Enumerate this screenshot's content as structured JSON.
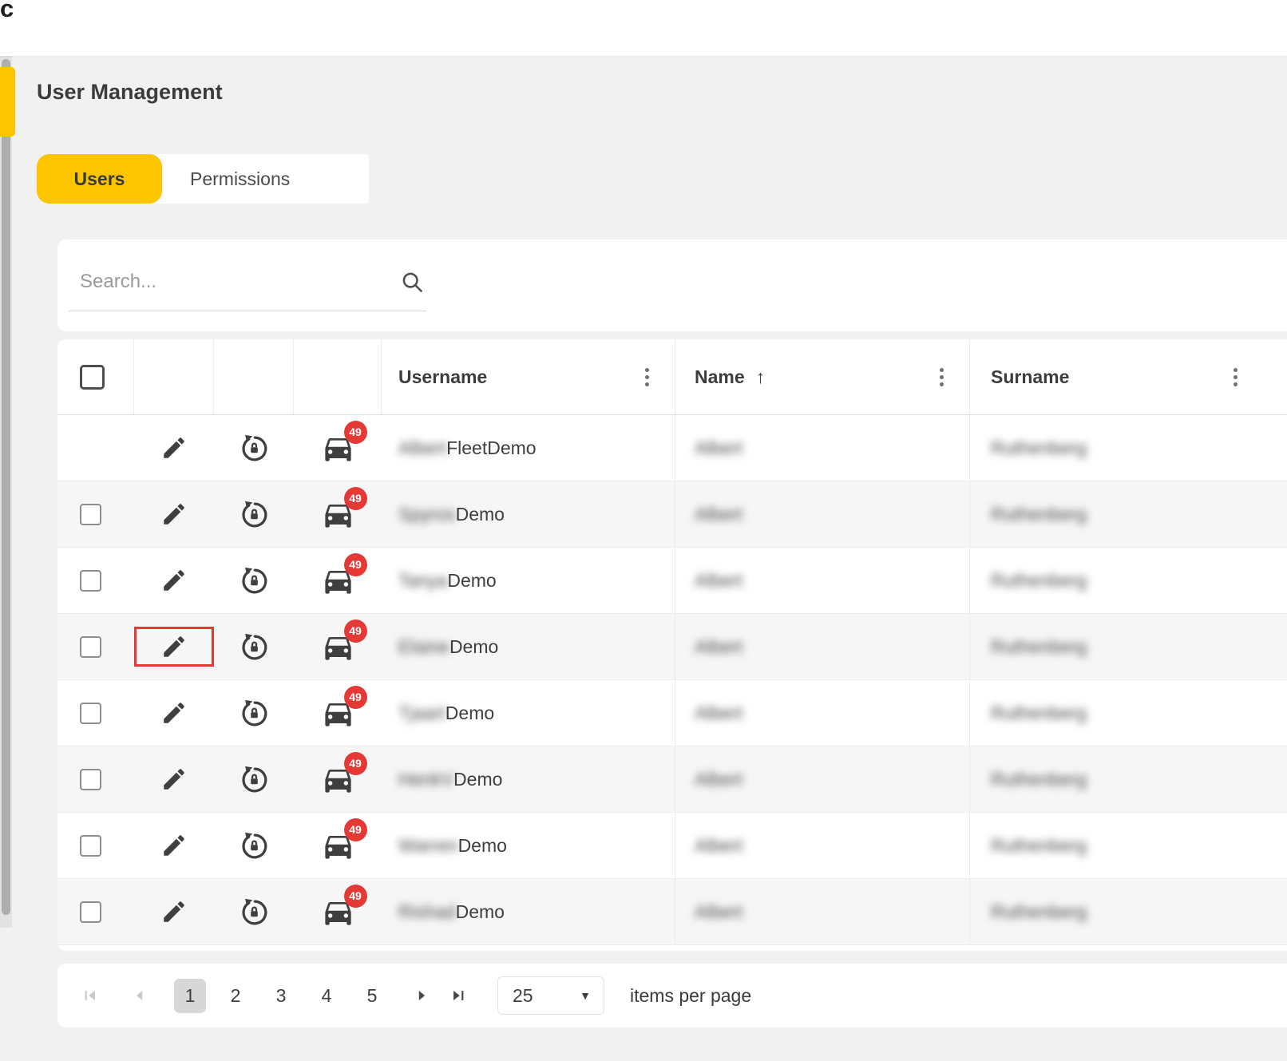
{
  "window": {
    "corner_letter": "c"
  },
  "header": {
    "title": "User Management"
  },
  "tabs": {
    "users": "Users",
    "permissions": "Permissions"
  },
  "search": {
    "placeholder": "Search..."
  },
  "table": {
    "columns": {
      "username": "Username",
      "name": "Name",
      "name_sort": "↑",
      "surname": "Surname"
    },
    "rows": [
      {
        "username_private": "Albert",
        "username_public": "FleetDemo",
        "name": "Albert",
        "surname": "Ruthenberg",
        "vehicle_badge": "49"
      },
      {
        "username_private": "Spyros",
        "username_public": "Demo",
        "name": "Albert",
        "surname": "Ruthenberg",
        "vehicle_badge": "49"
      },
      {
        "username_private": "Tanya",
        "username_public": "Demo",
        "name": "Albert",
        "surname": "Ruthenberg",
        "vehicle_badge": "49"
      },
      {
        "username_private": "Elaine",
        "username_public": "Demo",
        "name": "Albert",
        "surname": "Ruthenberg",
        "vehicle_badge": "49"
      },
      {
        "username_private": "Tjaart",
        "username_public": "Demo",
        "name": "Albert",
        "surname": "Ruthenberg",
        "vehicle_badge": "49"
      },
      {
        "username_private": "HenkV",
        "username_public": "Demo",
        "name": "Albert",
        "surname": "Ruthenberg",
        "vehicle_badge": "49"
      },
      {
        "username_private": "Warren",
        "username_public": "Demo",
        "name": "Albert",
        "surname": "Ruthenberg",
        "vehicle_badge": "49"
      },
      {
        "username_private": "Rishad",
        "username_public": "Demo",
        "name": "Albert",
        "surname": "Ruthenberg",
        "vehicle_badge": "49"
      }
    ]
  },
  "pagination": {
    "pages": [
      "1",
      "2",
      "3",
      "4",
      "5"
    ],
    "current_page": "1",
    "page_size": "25",
    "items_per_page_label": "items per page"
  },
  "colors": {
    "accent_yellow": "#fdc500",
    "badge_red": "#e53935",
    "highlight_red": "#e53935"
  }
}
